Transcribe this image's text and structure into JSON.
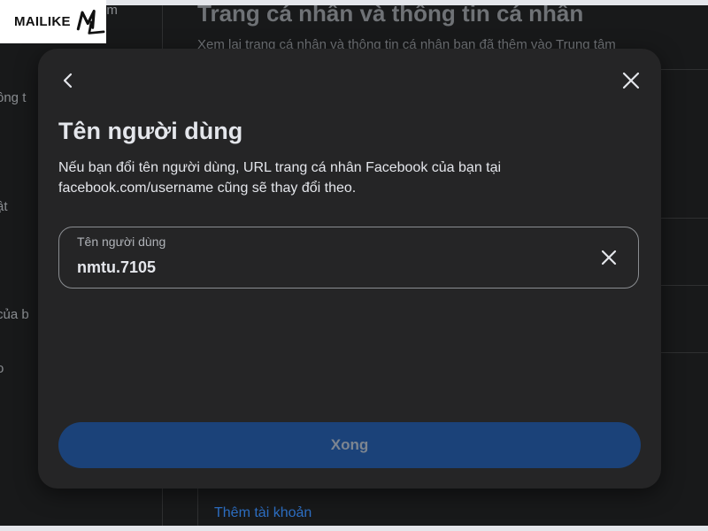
{
  "logo": {
    "text": "MAILIKE",
    "mark": "ML"
  },
  "background": {
    "title": "Trang cá nhân và thông tin cá nhân",
    "subtitle": "Xem lại trang cá nhân và thông tin cá nhân bạn đã thêm vào Trung tâm",
    "sidebar_fragments": [
      "ông t",
      "ật",
      "của b",
      "o",
      "em"
    ],
    "add_account_link": "Thêm tài khoản"
  },
  "modal": {
    "title": "Tên người dùng",
    "description": "Nếu bạn đổi tên người dùng, URL trang cá nhân Facebook của bạn tại facebook.com/username cũng sẽ thay đổi theo.",
    "field": {
      "label": "Tên người dùng",
      "value": "nmtu.7105"
    },
    "done_label": "Xong",
    "icons": {
      "back": "chevron-left-icon",
      "close": "close-icon",
      "clear": "clear-icon"
    }
  },
  "colors": {
    "modal_bg": "#252526",
    "page_bg": "#18191a",
    "text_primary": "#e4e6eb",
    "text_secondary": "#b0b3b8",
    "done_button_bg": "#1b4279",
    "done_button_text": "#7d8590",
    "link": "#2d6fc4"
  }
}
